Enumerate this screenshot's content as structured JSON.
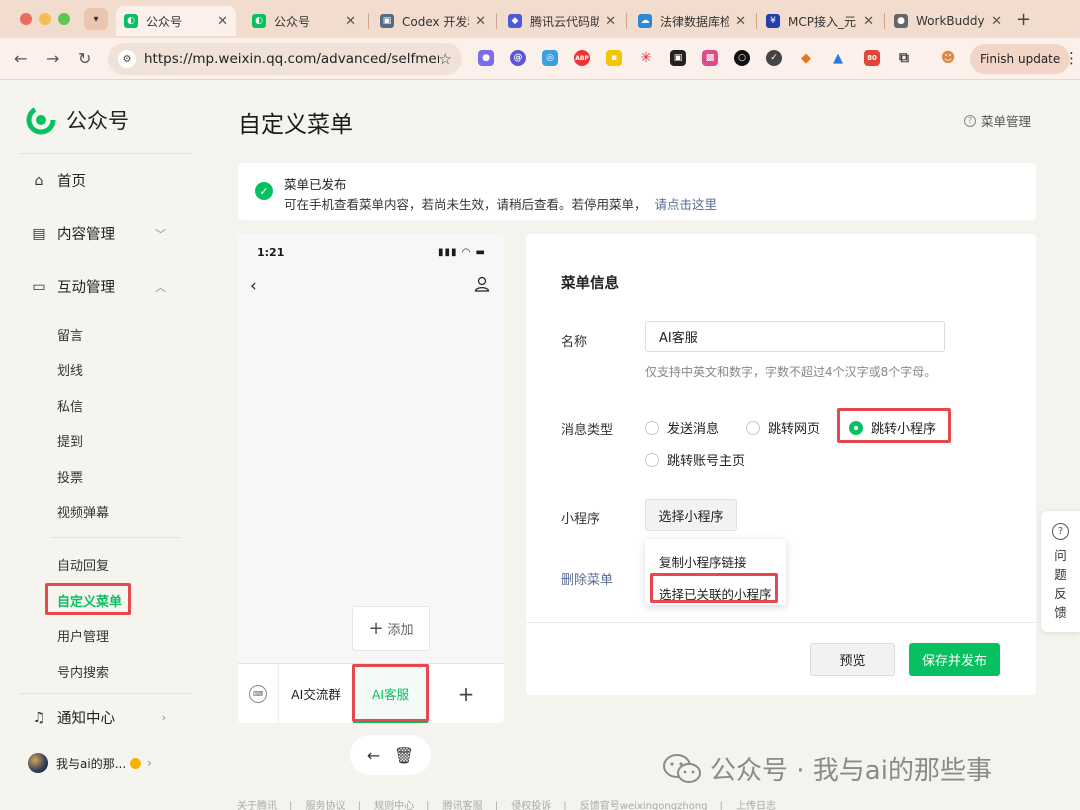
{
  "browser": {
    "tabs": [
      {
        "title": "公众号",
        "active": true,
        "fav": "wechat-mp"
      },
      {
        "title": "公众号",
        "active": false,
        "fav": "wechat-mp"
      },
      {
        "title": "Codex 开发和",
        "active": false,
        "fav": "codex"
      },
      {
        "title": "腾讯云代码助",
        "active": false,
        "fav": "tencent-cloud"
      },
      {
        "title": "法律数据库检",
        "active": false,
        "fav": "cloud"
      },
      {
        "title": "MCP接入_元",
        "active": false,
        "fav": "yuanbao"
      },
      {
        "title": "WorkBuddy",
        "active": false,
        "fav": "globe"
      }
    ],
    "url": "https://mp.weixin.qq.com/advanced/selfmenu...",
    "finish_update": "Finish update",
    "ext_badge": "80"
  },
  "sidebar": {
    "logo_text": "公众号",
    "home": "首页",
    "content_mgmt": "内容管理",
    "interaction_mgmt": "互动管理",
    "sub_interaction": [
      "留言",
      "划线",
      "私信",
      "提到",
      "投票",
      "视频弹幕"
    ],
    "sub_tools": [
      "自动回复",
      "自定义菜单",
      "用户管理",
      "号内搜索"
    ],
    "notice_center": "通知中心",
    "account_name": "我与ai的那..."
  },
  "main": {
    "title": "自定义菜单",
    "menu_mgmt": "菜单管理",
    "notice": {
      "title": "菜单已发布",
      "desc": "可在手机查看菜单内容，若尚未生效，请稍后查看。若停用菜单，",
      "link": "请点击这里"
    },
    "phone": {
      "time": "1:21",
      "add_label": "添加",
      "menus": [
        "AI交流群",
        "AI客服"
      ]
    },
    "form": {
      "section_title": "菜单信息",
      "name_label": "名称",
      "name_value": "AI客服",
      "name_hint": "仅支持中英文和数字，字数不超过4个汉字或8个字母。",
      "type_label": "消息类型",
      "types": [
        "发送消息",
        "跳转网页",
        "跳转小程序",
        "跳转账号主页"
      ],
      "selected_type": "跳转小程序",
      "mini_label": "小程序",
      "pick_btn": "选择小程序",
      "dropdown": [
        "复制小程序链接",
        "选择已关联的小程序"
      ],
      "delete": "删除菜单",
      "preview": "预览",
      "publish": "保存并发布"
    }
  },
  "feedback": [
    "问",
    "题",
    "反",
    "馈"
  ],
  "footer": [
    "关于腾讯",
    "服务协议",
    "规则中心",
    "腾讯客服",
    "侵权投诉",
    "反馈官号weixingongzhong",
    "上传日志"
  ],
  "watermark": "公众号 · 我与ai的那些事",
  "colors": {
    "accent": "#07c160",
    "highlight": "#e5484d",
    "link": "#576b95"
  }
}
